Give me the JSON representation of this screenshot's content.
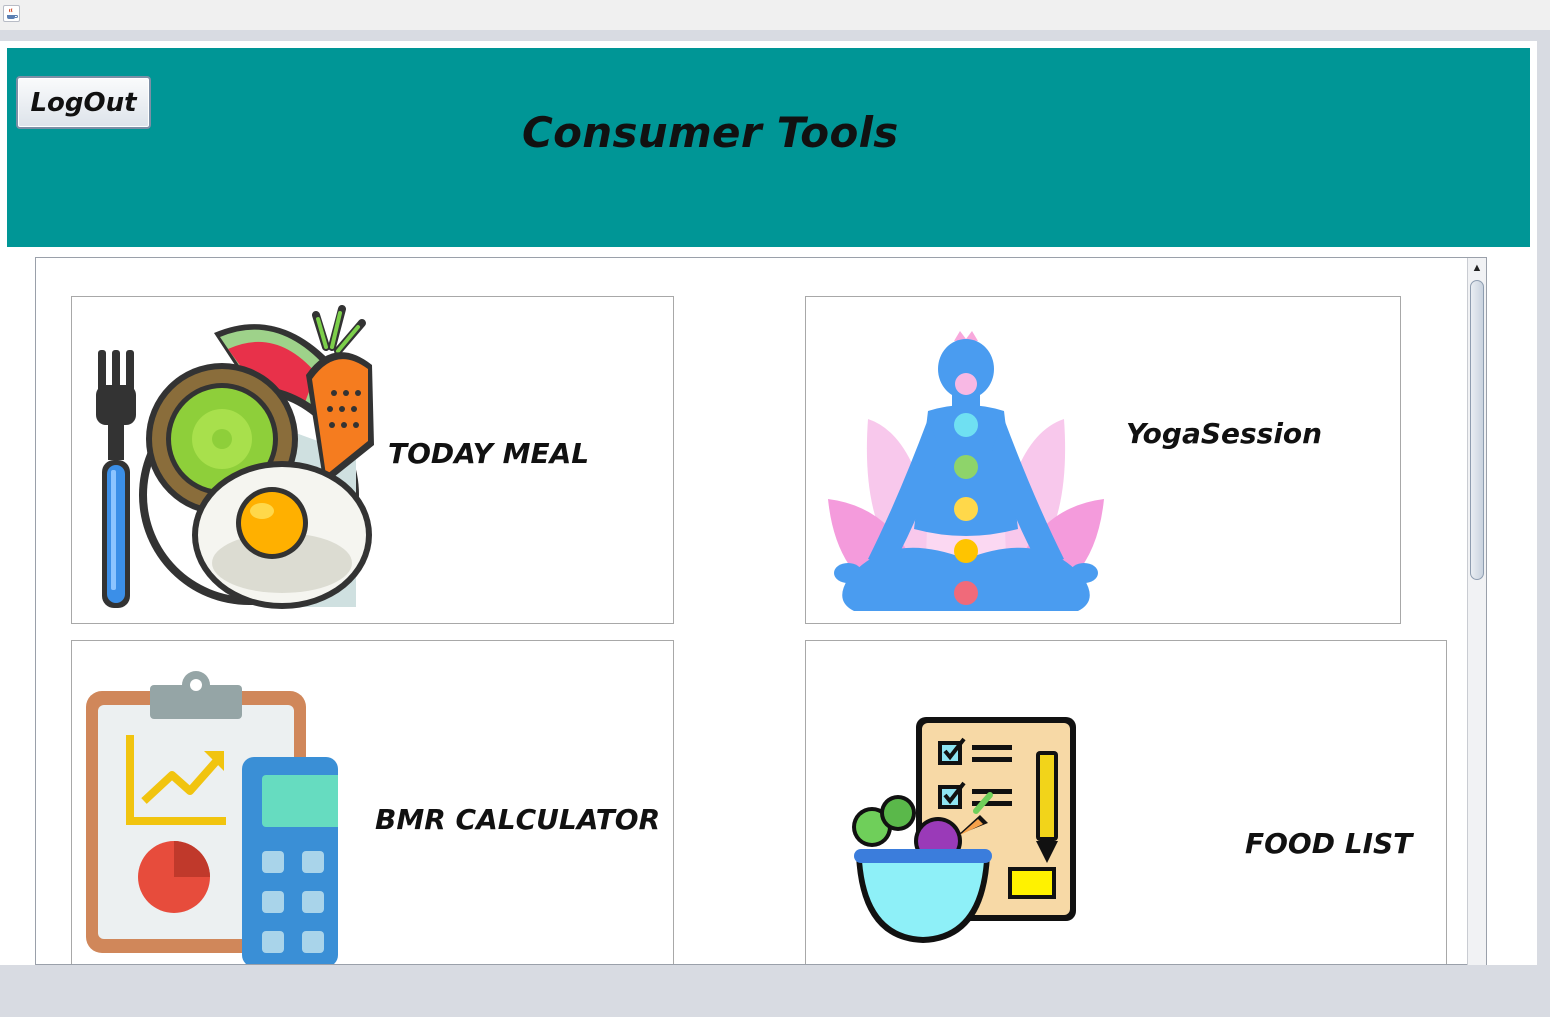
{
  "window": {
    "icon": "java-coffee-icon"
  },
  "header": {
    "logout_label": "LogOut",
    "title": "Consumer Tools",
    "background": "#009696"
  },
  "cards": [
    {
      "label": "TODAY MEAL",
      "icon": "meal-plate-icon"
    },
    {
      "label": "YogaSession",
      "icon": "yoga-meditation-icon"
    },
    {
      "label": "BMR CALCULATOR",
      "icon": "bmr-clipboard-calculator-icon"
    },
    {
      "label": "FOOD LIST",
      "icon": "food-checklist-icon"
    }
  ]
}
